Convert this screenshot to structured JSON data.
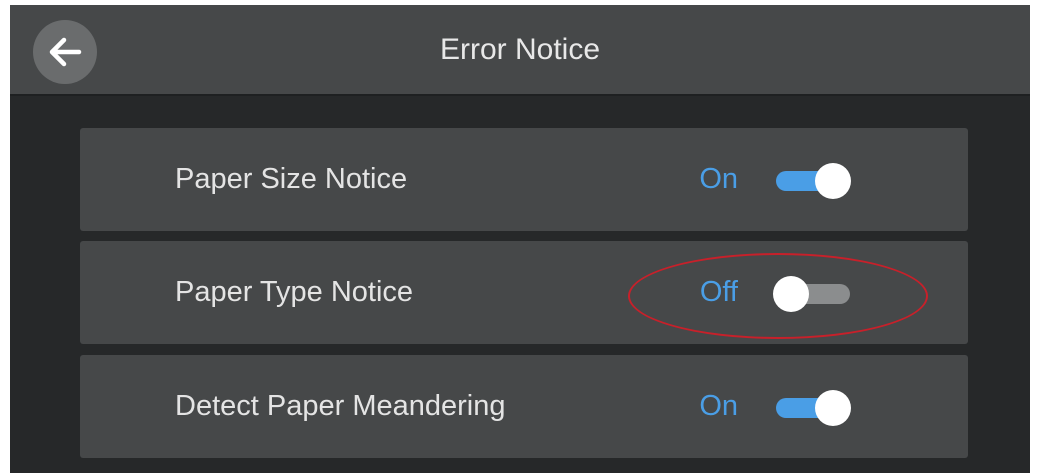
{
  "header": {
    "title": "Error Notice",
    "back_icon": "arrow-left-icon"
  },
  "settings": [
    {
      "label": "Paper Size Notice",
      "state": "On",
      "enabled": true
    },
    {
      "label": "Paper Type Notice",
      "state": "Off",
      "enabled": false
    },
    {
      "label": "Detect Paper Meandering",
      "state": "On",
      "enabled": true
    }
  ],
  "colors": {
    "accent": "#4a9ee6",
    "highlight": "#c8202a",
    "panel": "#464849",
    "background": "#262829"
  }
}
